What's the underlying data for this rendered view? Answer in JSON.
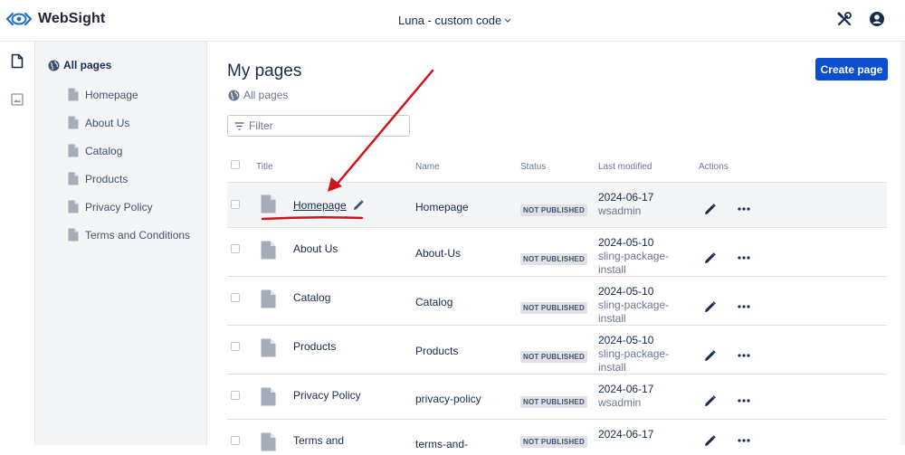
{
  "app": {
    "name": "WebSight",
    "project": "Luna - custom code"
  },
  "sidebar": {
    "root_label": "All pages",
    "items": [
      {
        "label": "Homepage"
      },
      {
        "label": "About Us"
      },
      {
        "label": "Catalog"
      },
      {
        "label": "Products"
      },
      {
        "label": "Privacy Policy"
      },
      {
        "label": "Terms and Conditions"
      }
    ]
  },
  "main": {
    "title": "My pages",
    "breadcrumb": "All pages",
    "create_button": "Create page",
    "filter_placeholder": "Filter"
  },
  "table": {
    "headers": {
      "title": "Title",
      "name": "Name",
      "status": "Status",
      "last_modified": "Last modified",
      "actions": "Actions"
    },
    "rows": [
      {
        "title": "Homepage",
        "name": "Homepage",
        "status": "NOT PUBLISHED",
        "date": "2024-06-17",
        "by1": "wsadmin",
        "by2": ""
      },
      {
        "title": "About Us",
        "name": "About-Us",
        "status": "NOT PUBLISHED",
        "date": "2024-05-10",
        "by1": "sling-package-",
        "by2": "install"
      },
      {
        "title": "Catalog",
        "name": "Catalog",
        "status": "NOT PUBLISHED",
        "date": "2024-05-10",
        "by1": "sling-package-",
        "by2": "install"
      },
      {
        "title": "Products",
        "name": "Products",
        "status": "NOT PUBLISHED",
        "date": "2024-05-10",
        "by1": "sling-package-",
        "by2": "install"
      },
      {
        "title": "Privacy Policy",
        "name": "privacy-policy",
        "status": "NOT PUBLISHED",
        "date": "2024-06-17",
        "by1": "wsadmin",
        "by2": ""
      },
      {
        "title": "Terms and",
        "name": "terms-and-",
        "status": "NOT PUBLISHED",
        "date": "2024-06-17",
        "by1": "",
        "by2": ""
      }
    ]
  },
  "colors": {
    "accent": "#0b4fcf",
    "annotation": "#d0141b",
    "sidebar_bg": "#f4f5f7"
  }
}
